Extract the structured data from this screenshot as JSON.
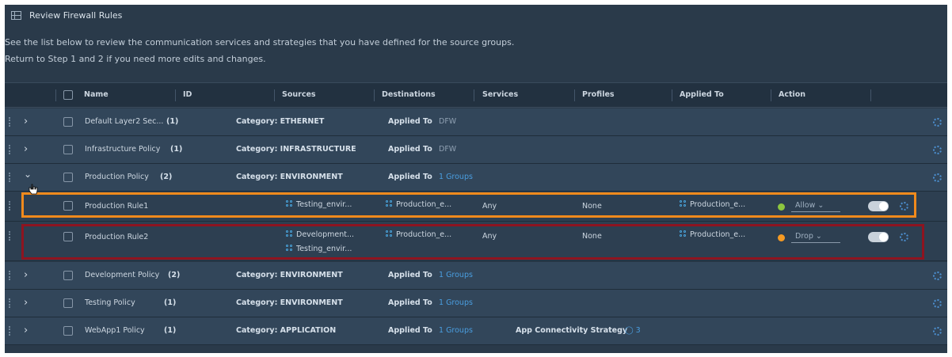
{
  "panel": {
    "title": "Review Firewall Rules",
    "description_line1": "See the list below to review the communication services and strategies that you have defined for the source groups.",
    "description_line2": "Return to Step 1 and 2 if you need more edits and changes."
  },
  "table": {
    "columns": [
      "Name",
      "ID",
      "Sources",
      "Destinations",
      "Services",
      "Profiles",
      "Applied To",
      "Action"
    ],
    "policies": [
      {
        "name": "Default Layer2 Sec...",
        "count": "(1)",
        "category": "Category: ETHERNET",
        "applied_to_label": "Applied To",
        "applied_to_value": "DFW",
        "expanded": false
      },
      {
        "name": "Infrastructure Policy",
        "count": "(1)",
        "category": "Category: INFRASTRUCTURE",
        "applied_to_label": "Applied To",
        "applied_to_value": "DFW",
        "expanded": false
      },
      {
        "name": "Production Policy",
        "count": "(2)",
        "category": "Category: ENVIRONMENT",
        "applied_to_label": "Applied To",
        "applied_to_value": "1 Groups",
        "expanded": true
      },
      {
        "name": "Development Policy",
        "count": "(2)",
        "category": "Category: ENVIRONMENT",
        "applied_to_label": "Applied To",
        "applied_to_value": "1 Groups",
        "expanded": false
      },
      {
        "name": "Testing Policy",
        "count": "(1)",
        "category": "Category: ENVIRONMENT",
        "applied_to_label": "Applied To",
        "applied_to_value": "1 Groups",
        "expanded": false
      },
      {
        "name": "WebApp1 Policy",
        "count": "(1)",
        "category": "Category: APPLICATION",
        "applied_to_label": "Applied To",
        "applied_to_value": "1 Groups",
        "strategy": "App Connectivity Strategy",
        "strategy_count": "3",
        "expanded": false
      }
    ],
    "rules": [
      {
        "name": "Production Rule1",
        "sources": [
          "Testing_envir..."
        ],
        "destination": "Production_e...",
        "service": "Any",
        "profile": "None",
        "applied_to": "Production_e...",
        "action": "Allow",
        "status_color": "#8cc63f",
        "enabled": true
      },
      {
        "name": "Production Rule2",
        "sources": [
          "Development...",
          "Testing_envir..."
        ],
        "destination": "Production_e...",
        "service": "Any",
        "profile": "None",
        "applied_to": "Production_e...",
        "action": "Drop",
        "status_color": "#f59a23",
        "enabled": true
      }
    ]
  },
  "colors": {
    "highlight_rule1": "#f08a1c",
    "highlight_rule2": "#8e1420",
    "link": "#4a9ee0"
  },
  "icons": {
    "title": "firewall-grid-icon",
    "row_settings": "gear-icon",
    "group": "group-icon",
    "expand": "chevron-right-icon",
    "collapse": "chevron-down-icon",
    "strategy": "strategy-check-icon"
  }
}
